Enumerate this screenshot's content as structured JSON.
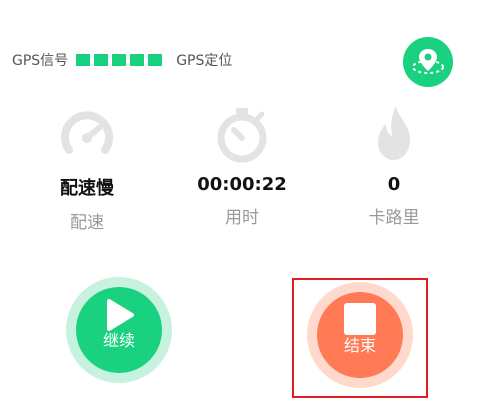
{
  "gps": {
    "signal_label": "GPS信号",
    "signal_bars": 5,
    "status_label": "GPS定位"
  },
  "stats": [
    {
      "icon": "speedometer-icon",
      "value": "配速慢",
      "label": "配速"
    },
    {
      "icon": "stopwatch-icon",
      "value": "00:00:22",
      "label": "用时"
    },
    {
      "icon": "flame-icon",
      "value": "0",
      "label": "卡路里"
    }
  ],
  "controls": {
    "continue_label": "继续",
    "end_label": "结束"
  },
  "colors": {
    "accent_green": "#19d17f",
    "stop_orange": "#ff7a55",
    "icon_gray": "#e3e3e3",
    "highlight_red": "#e02020"
  }
}
